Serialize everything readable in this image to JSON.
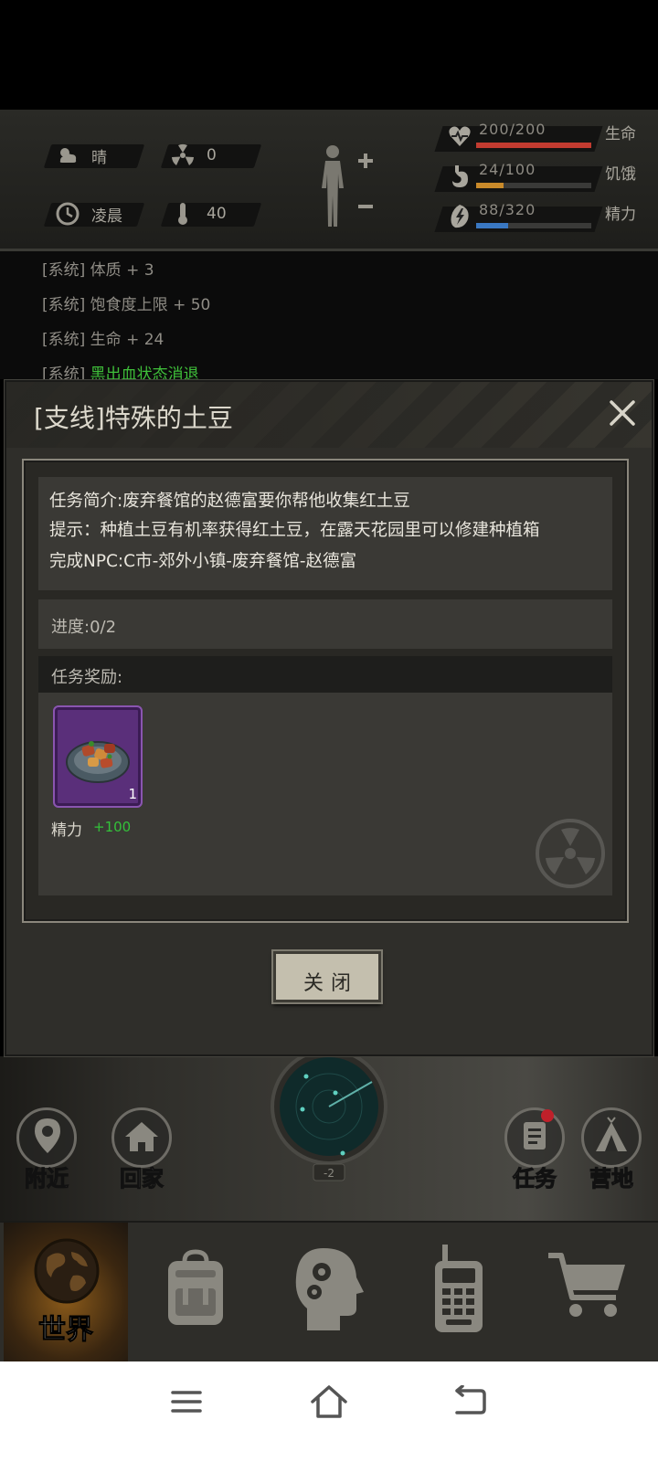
{
  "status": {
    "weather": "晴",
    "radiation": "0",
    "time_of_day": "凌晨",
    "temperature": "40",
    "health": {
      "text": "200/200",
      "label": "生命",
      "fraction": 1.0,
      "color": "#c23b30"
    },
    "hunger": {
      "text": "24/100",
      "label": "饥饿",
      "fraction": 0.24,
      "color": "#c98a2a"
    },
    "energy": {
      "text": "88/320",
      "label": "精力",
      "fraction": 0.275,
      "color": "#3a78c2"
    }
  },
  "log": {
    "line1": "[系统] 体质 + 3",
    "line2": "[系统] 饱食度上限 + 50",
    "line3": "[系统] 生命 + 24",
    "line4_prefix": "[系统] ",
    "line4_green": "黑出血状态消退"
  },
  "dialog": {
    "title": "[支线]特殊的土豆",
    "desc_1": "任务简介:废弃餐馆的赵德富要你帮他收集红土豆",
    "desc_2": "提示：种植土豆有机率获得红土豆，在露天花园里可以修建种植箱",
    "desc_3": "完成NPC:C市-郊外小镇-废弃餐馆-赵德富",
    "progress": "进度:0/2",
    "reward_header": "任务奖励:",
    "reward_qty": "1",
    "reward_label": "精力",
    "reward_value": "+100",
    "close_label": "关闭"
  },
  "scene": {
    "nearby": "附近",
    "home": "回家",
    "quest": "任务",
    "camp": "营地",
    "radar_level": "-2"
  },
  "nav": {
    "world": "世界"
  }
}
